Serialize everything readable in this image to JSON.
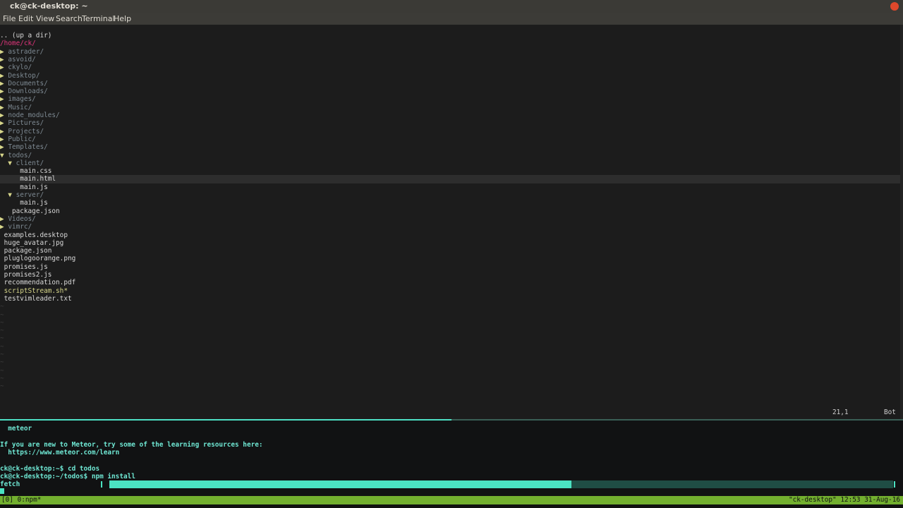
{
  "window": {
    "title": "ck@ck-desktop: ~"
  },
  "menu": [
    "File",
    "Edit",
    "View",
    "Search",
    "Terminal",
    "Help"
  ],
  "tree": {
    "up": ".. (up a dir)",
    "root": "/home/ck/",
    "items": [
      {
        "indent": 0,
        "arrow": "▶",
        "name": "astrader/",
        "type": "dir"
      },
      {
        "indent": 0,
        "arrow": "▶",
        "name": "asvoid/",
        "type": "dir"
      },
      {
        "indent": 0,
        "arrow": "▶",
        "name": "ckylo/",
        "type": "dir"
      },
      {
        "indent": 0,
        "arrow": "▶",
        "name": "Desktop/",
        "type": "dir"
      },
      {
        "indent": 0,
        "arrow": "▶",
        "name": "Documents/",
        "type": "dir"
      },
      {
        "indent": 0,
        "arrow": "▶",
        "name": "Downloads/",
        "type": "dir"
      },
      {
        "indent": 0,
        "arrow": "▶",
        "name": "images/",
        "type": "dir"
      },
      {
        "indent": 0,
        "arrow": "▶",
        "name": "Music/",
        "type": "dir"
      },
      {
        "indent": 0,
        "arrow": "▶",
        "name": "node_modules/",
        "type": "dir"
      },
      {
        "indent": 0,
        "arrow": "▶",
        "name": "Pictures/",
        "type": "dir"
      },
      {
        "indent": 0,
        "arrow": "▶",
        "name": "Projects/",
        "type": "dir"
      },
      {
        "indent": 0,
        "arrow": "▶",
        "name": "Public/",
        "type": "dir"
      },
      {
        "indent": 0,
        "arrow": "▶",
        "name": "Templates/",
        "type": "dir"
      },
      {
        "indent": 0,
        "arrow": "▼",
        "name": "todos/",
        "type": "dir"
      },
      {
        "indent": 1,
        "arrow": "▼",
        "name": "client/",
        "type": "dir"
      },
      {
        "indent": 2,
        "arrow": "",
        "name": "main.css",
        "type": "file"
      },
      {
        "indent": 2,
        "arrow": "",
        "name": "main.html",
        "type": "file",
        "cursor": true
      },
      {
        "indent": 2,
        "arrow": "",
        "name": "main.js",
        "type": "file"
      },
      {
        "indent": 1,
        "arrow": "▼",
        "name": "server/",
        "type": "dir"
      },
      {
        "indent": 2,
        "arrow": "",
        "name": "main.js",
        "type": "file"
      },
      {
        "indent": 1,
        "arrow": "",
        "name": "package.json",
        "type": "file"
      },
      {
        "indent": 0,
        "arrow": "▶",
        "name": "Videos/",
        "type": "dir"
      },
      {
        "indent": 0,
        "arrow": "▶",
        "name": "vimrc/",
        "type": "dir"
      },
      {
        "indent": 0,
        "arrow": "",
        "name": "examples.desktop",
        "type": "file"
      },
      {
        "indent": 0,
        "arrow": "",
        "name": "huge_avatar.jpg",
        "type": "file"
      },
      {
        "indent": 0,
        "arrow": "",
        "name": "package.json",
        "type": "file"
      },
      {
        "indent": 0,
        "arrow": "",
        "name": "pluglogoorange.png",
        "type": "file"
      },
      {
        "indent": 0,
        "arrow": "",
        "name": "promises.js",
        "type": "file"
      },
      {
        "indent": 0,
        "arrow": "",
        "name": "promises2.js",
        "type": "file"
      },
      {
        "indent": 0,
        "arrow": "",
        "name": "recommendation.pdf",
        "type": "file"
      },
      {
        "indent": 0,
        "arrow": "",
        "name": "scriptStream.sh*",
        "type": "exec"
      },
      {
        "indent": 0,
        "arrow": "",
        "name": "testvimleader.txt",
        "type": "file"
      }
    ],
    "tilde_count": 11
  },
  "vim_status": {
    "position": "21,1",
    "scroll": "Bot"
  },
  "terminal": {
    "lines": [
      "  meteor",
      "",
      "If you are new to Meteor, try some of the learning resources here:",
      "  https://www.meteor.com/learn",
      "",
      "ck@ck-desktop:~$ cd todos",
      "ck@ck-desktop:~/todos$ npm install",
      "fetch"
    ],
    "progress": 0.59
  },
  "tmux": {
    "left": "[0] 0:npm*",
    "right": "\"ck-desktop\" 12:53 31-Aug-16"
  }
}
